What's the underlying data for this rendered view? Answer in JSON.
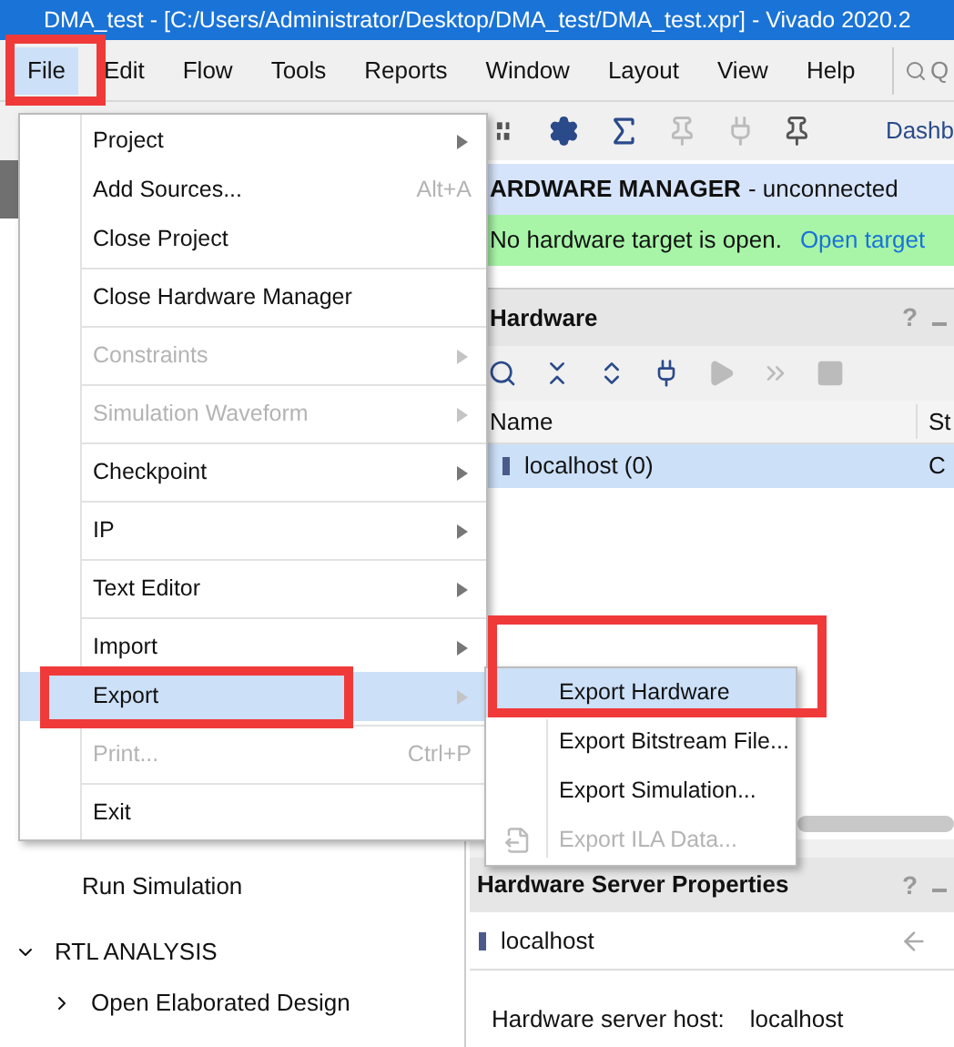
{
  "window": {
    "title": "DMA_test - [C:/Users/Administrator/Desktop/DMA_test/DMA_test.xpr] - Vivado 2020.2"
  },
  "menu_bar": [
    {
      "label": "File",
      "selected": true
    },
    {
      "label": "Edit",
      "selected": false
    },
    {
      "label": "Flow",
      "selected": false
    },
    {
      "label": "Tools",
      "selected": false
    },
    {
      "label": "Reports",
      "selected": false
    },
    {
      "label": "Window",
      "selected": false
    },
    {
      "label": "Layout",
      "selected": false
    },
    {
      "label": "View",
      "selected": false
    },
    {
      "label": "Help",
      "selected": false
    }
  ],
  "search": {
    "placeholder": "Q"
  },
  "toolbar": {
    "dashboard_label": "Dashb"
  },
  "flow_navigator": {
    "items": [
      {
        "kind": "item",
        "label": "Run Simulation"
      },
      {
        "kind": "section",
        "label": "RTL ANALYSIS",
        "expanded": true
      },
      {
        "kind": "item",
        "label": "Open Elaborated Design",
        "expanded": false
      }
    ]
  },
  "hardware_manager": {
    "title": "ARDWARE MANAGER",
    "status": "- unconnected",
    "message": "No hardware target is open.",
    "link": "Open target"
  },
  "hardware_panel": {
    "title": "Hardware",
    "help": "?",
    "columns": [
      "Name",
      "St"
    ],
    "rows": [
      {
        "name": "localhost (0)",
        "column_2": "C",
        "selected": true
      }
    ]
  },
  "properties_panel": {
    "title": "Hardware Server Properties",
    "help": "?",
    "object": "localhost",
    "fields": [
      {
        "label": "Hardware server host:",
        "value": "localhost"
      }
    ]
  },
  "file_menu": {
    "groups": [
      [
        {
          "label": "Project",
          "submenu": true,
          "disabled": false,
          "selected": false
        },
        {
          "label": "Add Sources...",
          "shortcut": "Alt+A",
          "submenu": false,
          "disabled": false,
          "selected": false
        },
        {
          "label": "Close Project",
          "submenu": false,
          "disabled": false,
          "selected": false
        }
      ],
      [
        {
          "label": "Close Hardware Manager",
          "submenu": false,
          "disabled": false,
          "selected": false
        }
      ],
      [
        {
          "label": "Constraints",
          "submenu": true,
          "disabled": true,
          "selected": false
        }
      ],
      [
        {
          "label": "Simulation Waveform",
          "submenu": true,
          "disabled": true,
          "selected": false
        }
      ],
      [
        {
          "label": "Checkpoint",
          "submenu": true,
          "disabled": false,
          "selected": false
        }
      ],
      [
        {
          "label": "IP",
          "submenu": true,
          "disabled": false,
          "selected": false
        }
      ],
      [
        {
          "label": "Text Editor",
          "submenu": true,
          "disabled": false,
          "selected": false
        }
      ],
      [
        {
          "label": "Import",
          "submenu": true,
          "disabled": false,
          "selected": false
        },
        {
          "label": "Export",
          "submenu": true,
          "disabled": false,
          "selected": true
        }
      ],
      [
        {
          "label": "Print...",
          "shortcut": "Ctrl+P",
          "submenu": false,
          "disabled": true,
          "selected": false
        }
      ],
      [
        {
          "label": "Exit",
          "submenu": false,
          "disabled": false,
          "selected": false
        }
      ]
    ]
  },
  "export_submenu": {
    "items": [
      {
        "label": "Export Hardware",
        "disabled": false,
        "selected": true
      },
      {
        "label": "Export Bitstream File...",
        "disabled": false,
        "selected": false
      },
      {
        "label": "Export Simulation...",
        "disabled": false,
        "selected": false
      },
      {
        "label": "Export ILA Data...",
        "disabled": true,
        "selected": false,
        "icon": true
      }
    ]
  }
}
